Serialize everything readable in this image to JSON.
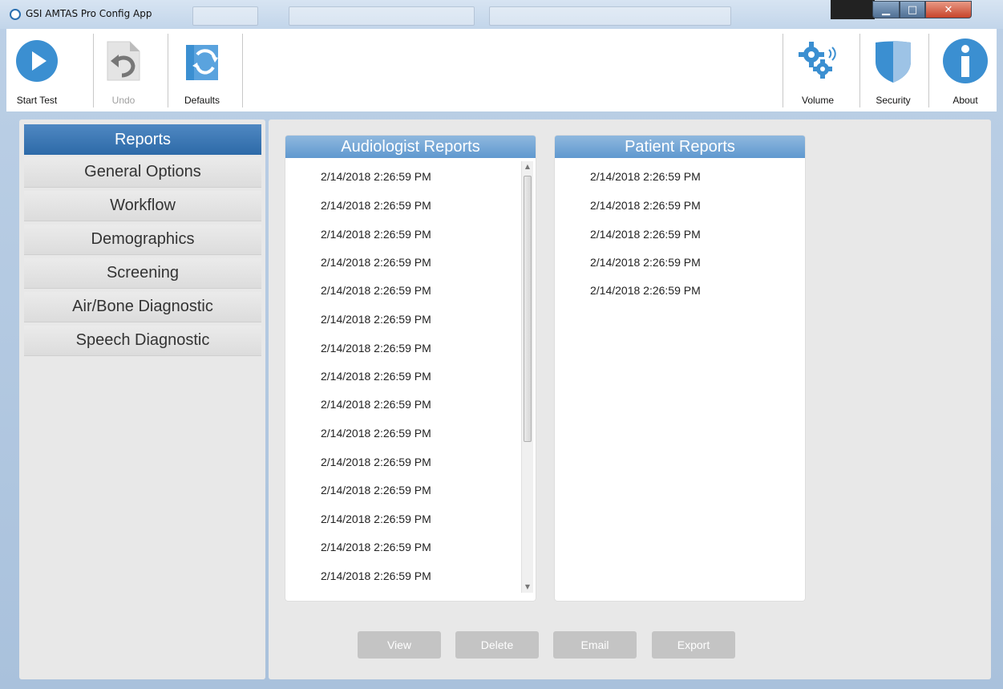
{
  "window": {
    "title": "GSI AMTAS Pro Config App"
  },
  "toolbar": {
    "start_test": "Start Test",
    "undo": "Undo",
    "defaults": "Defaults",
    "volume": "Volume",
    "security": "Security",
    "about": "About"
  },
  "nav": {
    "items": [
      {
        "label": "Reports",
        "active": true
      },
      {
        "label": "General Options"
      },
      {
        "label": "Workflow"
      },
      {
        "label": "Demographics"
      },
      {
        "label": "Screening"
      },
      {
        "label": "Air/Bone Diagnostic"
      },
      {
        "label": "Speech Diagnostic"
      }
    ]
  },
  "audiologist_reports": {
    "header": "Audiologist Reports",
    "rows": [
      "2/14/2018 2:26:59 PM",
      "2/14/2018 2:26:59 PM",
      "2/14/2018 2:26:59 PM",
      "2/14/2018 2:26:59 PM",
      "2/14/2018 2:26:59 PM",
      "2/14/2018 2:26:59 PM",
      "2/14/2018 2:26:59 PM",
      "2/14/2018 2:26:59 PM",
      "2/14/2018 2:26:59 PM",
      "2/14/2018 2:26:59 PM",
      "2/14/2018 2:26:59 PM",
      "2/14/2018 2:26:59 PM",
      "2/14/2018 2:26:59 PM",
      "2/14/2018 2:26:59 PM",
      "2/14/2018 2:26:59 PM"
    ]
  },
  "patient_reports": {
    "header": "Patient Reports",
    "rows": [
      "2/14/2018 2:26:59 PM",
      "2/14/2018 2:26:59 PM",
      "2/14/2018 2:26:59 PM",
      "2/14/2018 2:26:59 PM",
      "2/14/2018 2:26:59 PM"
    ]
  },
  "actions": {
    "view": "View",
    "delete": "Delete",
    "email": "Email",
    "export": "Export"
  },
  "colors": {
    "accent": "#2d6aa8",
    "icon_blue": "#3b8fd1",
    "disabled": "#c4c4c4"
  }
}
